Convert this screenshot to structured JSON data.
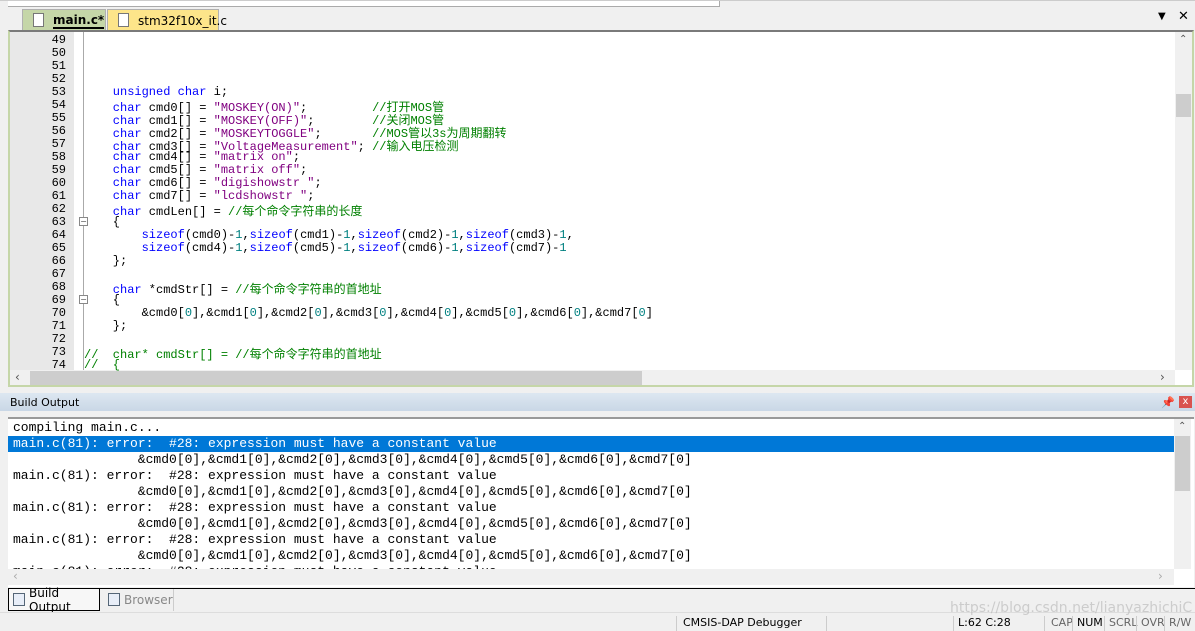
{
  "tabs": [
    {
      "label": "main.c*",
      "active": true
    },
    {
      "label": "stm32f10x_it.c",
      "active": false
    }
  ],
  "tab_controls": {
    "dropdown_icon": "▼",
    "close_icon": "✕"
  },
  "editor": {
    "first_line": 49,
    "lines": [
      [],
      [],
      [],
      [],
      [
        [
          "k",
          "    unsigned char"
        ],
        [
          "p",
          " i;"
        ]
      ],
      [
        [
          "k",
          "    char"
        ],
        [
          "p",
          " cmd0[] = "
        ],
        [
          "s",
          "\"MOSKEY(ON)\""
        ],
        [
          "p",
          ";         "
        ],
        [
          "c",
          "//打开MOS管"
        ]
      ],
      [
        [
          "k",
          "    char"
        ],
        [
          "p",
          " cmd1[] = "
        ],
        [
          "s",
          "\"MOSKEY(OFF)\""
        ],
        [
          "p",
          ";        "
        ],
        [
          "c",
          "//关闭MOS管"
        ]
      ],
      [
        [
          "k",
          "    char"
        ],
        [
          "p",
          " cmd2[] = "
        ],
        [
          "s",
          "\"MOSKEYTOGGLE\""
        ],
        [
          "p",
          ";       "
        ],
        [
          "c",
          "//MOS管以3s为周期翻转"
        ]
      ],
      [
        [
          "k",
          "    char"
        ],
        [
          "p",
          " cmd3[] = "
        ],
        [
          "s",
          "\"VoltageMeasurement\""
        ],
        [
          "p",
          "; "
        ],
        [
          "c",
          "//输入电压检测"
        ]
      ],
      [
        [
          "k",
          "    char"
        ],
        [
          "p",
          " cmd4[] = "
        ],
        [
          "s",
          "\"matrix on\""
        ],
        [
          "p",
          ";"
        ]
      ],
      [
        [
          "k",
          "    char"
        ],
        [
          "p",
          " cmd5[] = "
        ],
        [
          "s",
          "\"matrix off\""
        ],
        [
          "p",
          ";"
        ]
      ],
      [
        [
          "k",
          "    char"
        ],
        [
          "p",
          " cmd6[] = "
        ],
        [
          "s",
          "\"digishowstr \""
        ],
        [
          "p",
          ";"
        ]
      ],
      [
        [
          "k",
          "    char"
        ],
        [
          "p",
          " cmd7[] = "
        ],
        [
          "s",
          "\"lcdshowstr \""
        ],
        [
          "p",
          ";"
        ]
      ],
      [
        [
          "k",
          "    char"
        ],
        [
          "p",
          " cmdLen[] = "
        ],
        [
          "c",
          "//每个命令字符串的长度"
        ]
      ],
      [
        [
          "p",
          "    {"
        ]
      ],
      [
        [
          "k",
          "        sizeof"
        ],
        [
          "p",
          "(cmd0)-"
        ],
        [
          "n",
          "1"
        ],
        [
          "p",
          ","
        ],
        [
          "k",
          "sizeof"
        ],
        [
          "p",
          "(cmd1)-"
        ],
        [
          "n",
          "1"
        ],
        [
          "p",
          ","
        ],
        [
          "k",
          "sizeof"
        ],
        [
          "p",
          "(cmd2)-"
        ],
        [
          "n",
          "1"
        ],
        [
          "p",
          ","
        ],
        [
          "k",
          "sizeof"
        ],
        [
          "p",
          "(cmd3)-"
        ],
        [
          "n",
          "1"
        ],
        [
          "p",
          ","
        ]
      ],
      [
        [
          "k",
          "        sizeof"
        ],
        [
          "p",
          "(cmd4)-"
        ],
        [
          "n",
          "1"
        ],
        [
          "p",
          ","
        ],
        [
          "k",
          "sizeof"
        ],
        [
          "p",
          "(cmd5)-"
        ],
        [
          "n",
          "1"
        ],
        [
          "p",
          ","
        ],
        [
          "k",
          "sizeof"
        ],
        [
          "p",
          "(cmd6)-"
        ],
        [
          "n",
          "1"
        ],
        [
          "p",
          ","
        ],
        [
          "k",
          "sizeof"
        ],
        [
          "p",
          "(cmd7)-"
        ],
        [
          "n",
          "1"
        ]
      ],
      [
        [
          "p",
          "    };"
        ]
      ],
      [],
      [
        [
          "k",
          "    char"
        ],
        [
          "p",
          " *cmdStr[] = "
        ],
        [
          "c",
          "//每个命令字符串的首地址"
        ]
      ],
      [
        [
          "p",
          "    {"
        ]
      ],
      [
        [
          "p",
          "        &cmd0["
        ],
        [
          "n",
          "0"
        ],
        [
          "p",
          "],&cmd1["
        ],
        [
          "n",
          "0"
        ],
        [
          "p",
          "],&cmd2["
        ],
        [
          "n",
          "0"
        ],
        [
          "p",
          "],&cmd3["
        ],
        [
          "n",
          "0"
        ],
        [
          "p",
          "],&cmd4["
        ],
        [
          "n",
          "0"
        ],
        [
          "p",
          "],&cmd5["
        ],
        [
          "n",
          "0"
        ],
        [
          "p",
          "],&cmd6["
        ],
        [
          "n",
          "0"
        ],
        [
          "p",
          "],&cmd7["
        ],
        [
          "n",
          "0"
        ],
        [
          "p",
          "]"
        ]
      ],
      [
        [
          "p",
          "    };"
        ]
      ],
      [],
      [
        [
          "c",
          "//  char* cmdStr[] = //每个命令字符串的首地址"
        ]
      ],
      [
        [
          "c",
          "//  {"
        ]
      ]
    ],
    "fold_markers": [
      63,
      69
    ]
  },
  "build_output": {
    "title": "Build Output",
    "lines": [
      "compiling main.c...",
      "main.c(81): error:  #28: expression must have a constant value",
      "                &cmd0[0],&cmd1[0],&cmd2[0],&cmd3[0],&cmd4[0],&cmd5[0],&cmd6[0],&cmd7[0]",
      "main.c(81): error:  #28: expression must have a constant value",
      "                &cmd0[0],&cmd1[0],&cmd2[0],&cmd3[0],&cmd4[0],&cmd5[0],&cmd6[0],&cmd7[0]",
      "main.c(81): error:  #28: expression must have a constant value",
      "                &cmd0[0],&cmd1[0],&cmd2[0],&cmd3[0],&cmd4[0],&cmd5[0],&cmd6[0],&cmd7[0]",
      "main.c(81): error:  #28: expression must have a constant value",
      "                &cmd0[0],&cmd1[0],&cmd2[0],&cmd3[0],&cmd4[0],&cmd5[0],&cmd6[0],&cmd7[0]",
      "main.c(81): error:  #28: expression must have a constant value"
    ],
    "selected_index": 1
  },
  "bottom_tabs": [
    {
      "label": "Build Output",
      "active": true
    },
    {
      "label": "Browser",
      "active": false
    }
  ],
  "status": {
    "debugger": "CMSIS-DAP Debugger",
    "position": "L:62 C:28",
    "cap": "CAP",
    "num": "NUM",
    "scrl": "SCRL",
    "ovr": "OVR",
    "rw": "R/W"
  },
  "watermark": "https://blog.csdn.net/lianyazhichiC"
}
